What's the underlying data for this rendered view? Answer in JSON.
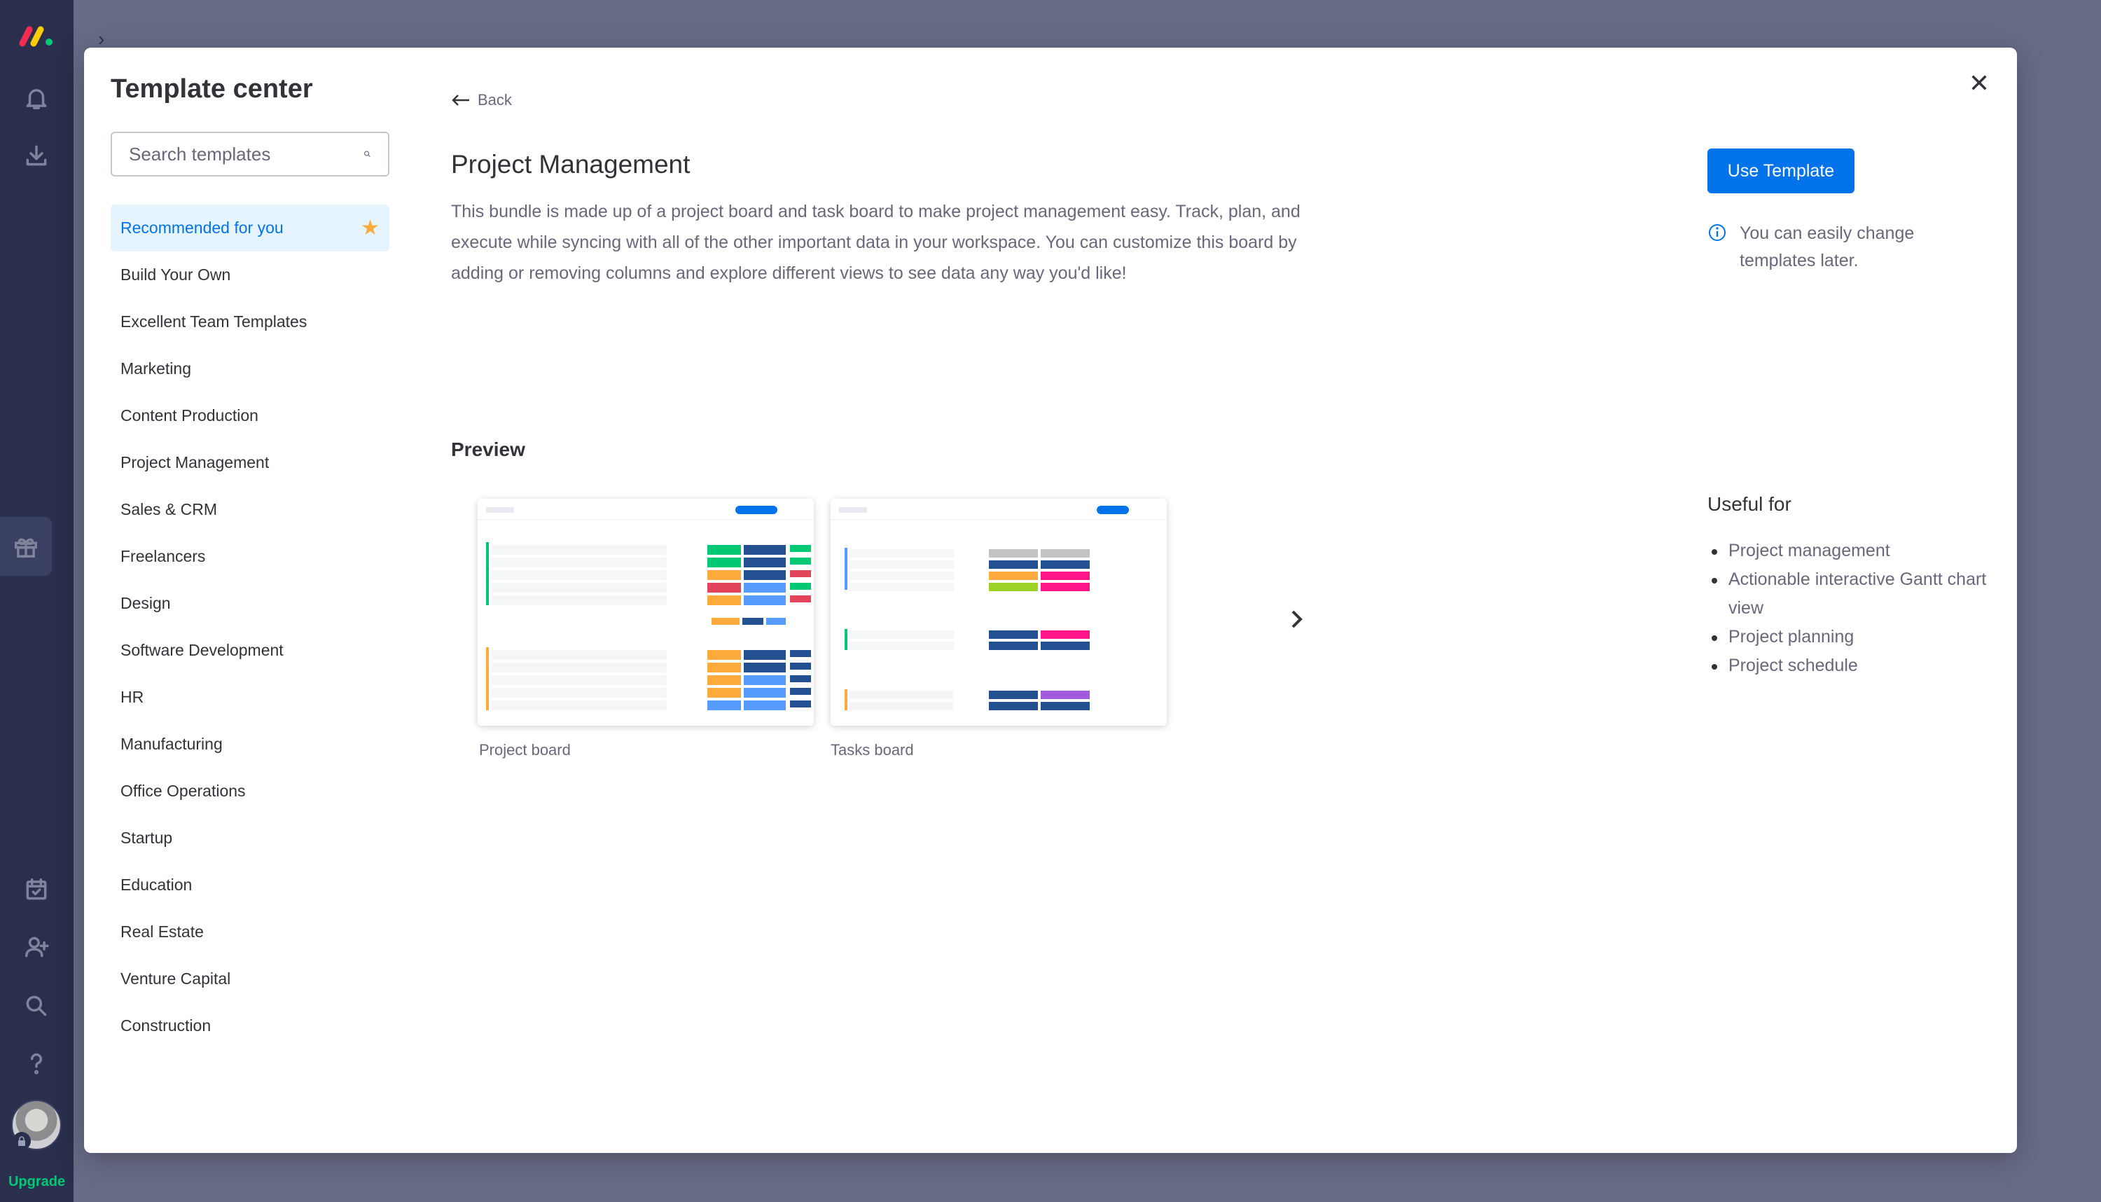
{
  "rail": {
    "upgrade_label": "Upgrade"
  },
  "modal": {
    "title": "Template center",
    "search": {
      "placeholder": "Search templates",
      "value": ""
    },
    "categories": [
      "Recommended for you",
      "Build Your Own",
      "Excellent Team Templates",
      "Marketing",
      "Content Production",
      "Project Management",
      "Sales & CRM",
      "Freelancers",
      "Design",
      "Software Development",
      "HR",
      "Manufacturing",
      "Office Operations",
      "Startup",
      "Education",
      "Real Estate",
      "Venture Capital",
      "Construction"
    ],
    "active_category": "Recommended for you",
    "back_label": "Back",
    "template_title": "Project Management",
    "description": "This bundle is made up of a project board and task board to make project management easy. Track, plan, and execute while syncing with all of the other important data in your workspace. You can customize this board by adding or removing columns and explore different views to see data any way you'd like!",
    "preview_title": "Preview",
    "previews": [
      {
        "label": "Project board"
      },
      {
        "label": "Tasks board"
      }
    ],
    "use_template_label": "Use Template",
    "info_text": "You can easily change templates later.",
    "useful_title": "Useful for",
    "useful_items": [
      "Project management",
      "Actionable interactive Gantt chart view",
      "Project planning",
      "Project schedule"
    ]
  },
  "colors": {
    "primary": "#0073ea",
    "rail_bg": "#292f4c",
    "overlay": "#676b85",
    "active_bg": "#e5f4ff",
    "star": "#fdab3d",
    "upgrade": "#00c875"
  },
  "icons": [
    "bell-icon",
    "download-icon",
    "gift-icon",
    "calendar-icon",
    "add-user-icon",
    "search-icon",
    "help-icon",
    "lock-icon",
    "close-icon",
    "arrow-left-icon",
    "chevron-right-icon",
    "info-icon",
    "star-icon"
  ]
}
